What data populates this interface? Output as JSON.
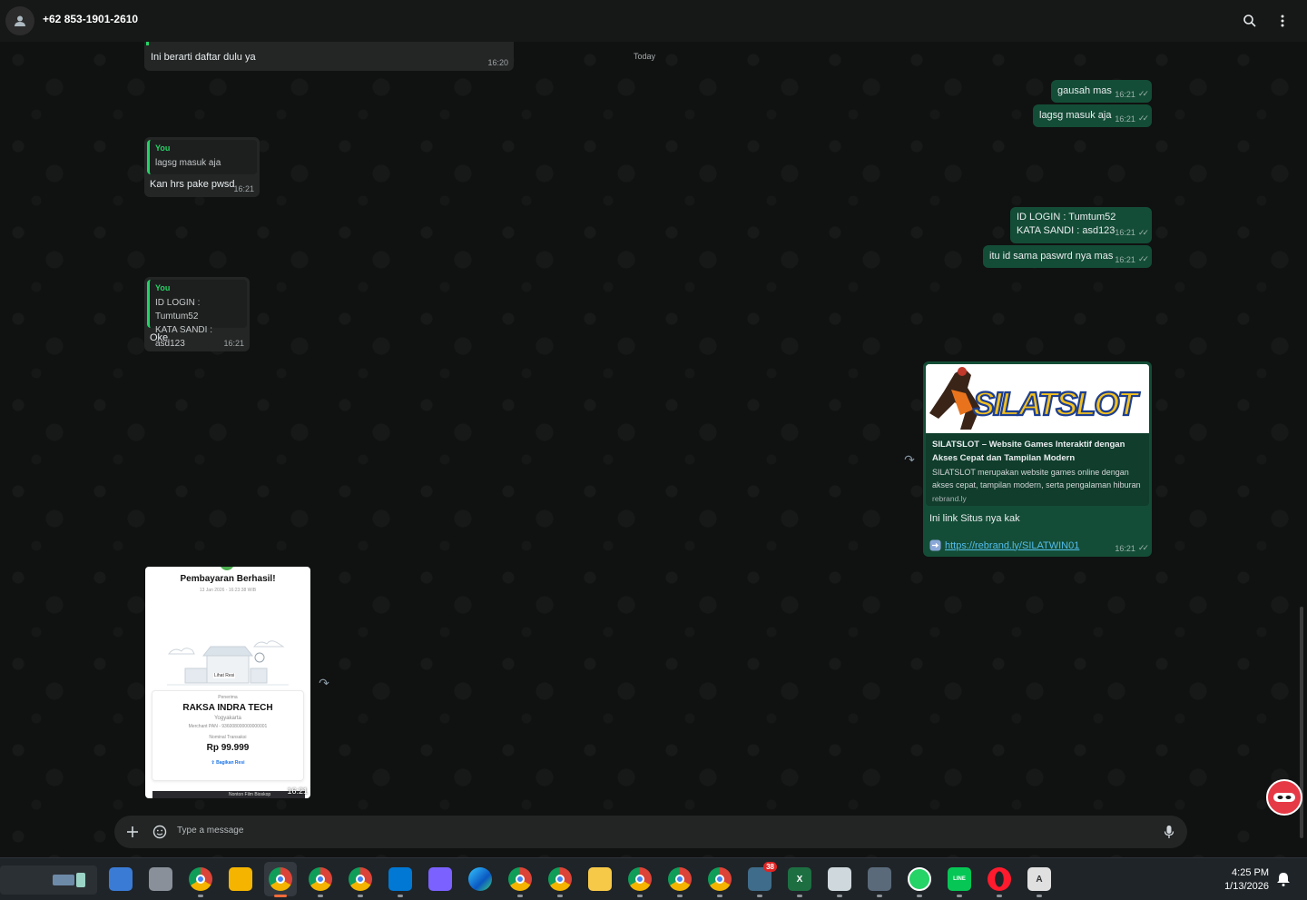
{
  "header": {
    "contact_name": "+62 853-1901-2610",
    "icons": [
      "avatar-icon",
      "search-icon",
      "menu-icon"
    ]
  },
  "chat": {
    "date_chip": "Today",
    "messages": [
      {
        "id": "m1",
        "direction": "in",
        "text": "Ini berarti daftar dulu ya",
        "time": "16:20"
      },
      {
        "id": "m2",
        "direction": "out",
        "text": "gausah mas",
        "time": "16:21"
      },
      {
        "id": "m3",
        "direction": "out",
        "text": "lagsg masuk aja",
        "time": "16:21"
      },
      {
        "id": "m4",
        "direction": "in",
        "quote_author": "You",
        "quote_text": "lagsg masuk aja",
        "text": "Kan hrs pake pwsd",
        "time": "16:21"
      },
      {
        "id": "m5",
        "direction": "out",
        "text_line1": "ID LOGIN : Tumtum52",
        "text_line2": "KATA SANDI : asd123",
        "time": "16:21"
      },
      {
        "id": "m6",
        "direction": "out",
        "text": "itu id sama paswrd nya mas",
        "time": "16:21"
      },
      {
        "id": "m7",
        "direction": "in",
        "quote_author": "You",
        "quote_line1": "ID LOGIN : Tumtum52",
        "quote_line2": "KATA SANDI : asd123",
        "text": "Oke",
        "time": "16:21"
      }
    ],
    "link_message": {
      "brand": "SILATSLOT",
      "preview_title": "SILATSLOT – Website Games Interaktif dengan Akses Cepat dan Tampilan Modern",
      "preview_desc": "SILATSLOT merupakan website games online dengan akses cepat, tampilan modern, serta pengalaman hiburan",
      "preview_domain": "rebrand.ly",
      "body": "Ini link Situs nya kak",
      "url": "https://rebrand.ly/SILATWIN01",
      "time": "16:21"
    },
    "receipt_image": {
      "title": "Pembayaran Berhasil!",
      "datetime": "13 Jan 2026 - 16:23:38 WIB",
      "view_receipt": "Lihat Resi",
      "merchant_label": "Penerima",
      "merchant": "RAKSA INDRA TECH",
      "city": "Yogyakarta",
      "merchant_pan": "Merchant PAN - 936008000000000001",
      "amount_label": "Nominal Transaksi",
      "amount": "Rp 99.999",
      "share": "Bagikan Resi",
      "bottom_strip": "Nonton Film Bioskop",
      "time": "16:21"
    }
  },
  "composer": {
    "placeholder": "Type a message",
    "icons": [
      "plus-icon",
      "sticker-icon",
      "microphone-icon"
    ]
  },
  "taskbar": {
    "apps": [
      {
        "name": "widgets",
        "color": "#3a7bd5"
      },
      {
        "name": "task-view",
        "color": "#8a9099"
      },
      {
        "name": "chrome",
        "color": "#db4437"
      },
      {
        "name": "file-explorer",
        "color": "#f4b400"
      },
      {
        "name": "chrome-profile-2",
        "color": "#db4437"
      },
      {
        "name": "chrome-profile-3",
        "color": "#db4437"
      },
      {
        "name": "chrome-profile-4",
        "color": "#db4437"
      },
      {
        "name": "microsoft-store",
        "color": "#0078d4"
      },
      {
        "name": "copilot",
        "color": "#7b61ff"
      },
      {
        "name": "edge",
        "color": "#0c9fd4"
      },
      {
        "name": "chrome-profile-5",
        "color": "#db4437"
      },
      {
        "name": "chrome-profile-6",
        "color": "#db4437"
      },
      {
        "name": "sticky-notes",
        "color": "#f7c948"
      },
      {
        "name": "chrome-profile-n",
        "color": "#db4437"
      },
      {
        "name": "chrome-profile-b",
        "color": "#0f9d58"
      },
      {
        "name": "chrome-profile-7",
        "color": "#db4437"
      },
      {
        "name": "app-with-badge",
        "color": "#3f6c8a"
      },
      {
        "name": "excel",
        "color": "#1d6f42"
      },
      {
        "name": "mail-app",
        "color": "#cfd8dc"
      },
      {
        "name": "calculator",
        "color": "#5a6a7a"
      },
      {
        "name": "whatsapp",
        "color": "#25d366"
      },
      {
        "name": "line",
        "color": "#06c755"
      },
      {
        "name": "opera",
        "color": "#ff1b2d"
      },
      {
        "name": "text-editor",
        "color": "#e0e0e0"
      }
    ],
    "badge_count": "38",
    "excel_letter": "X",
    "line_label": "LINE",
    "editor_letter": "A",
    "clock_time": "4:25 PM",
    "clock_date": "1/13/2026"
  },
  "colors": {
    "incoming_bubble": "#242626",
    "outgoing_bubble": "#144d37",
    "accent_green": "#25d366",
    "link_blue": "#53bdeb"
  }
}
